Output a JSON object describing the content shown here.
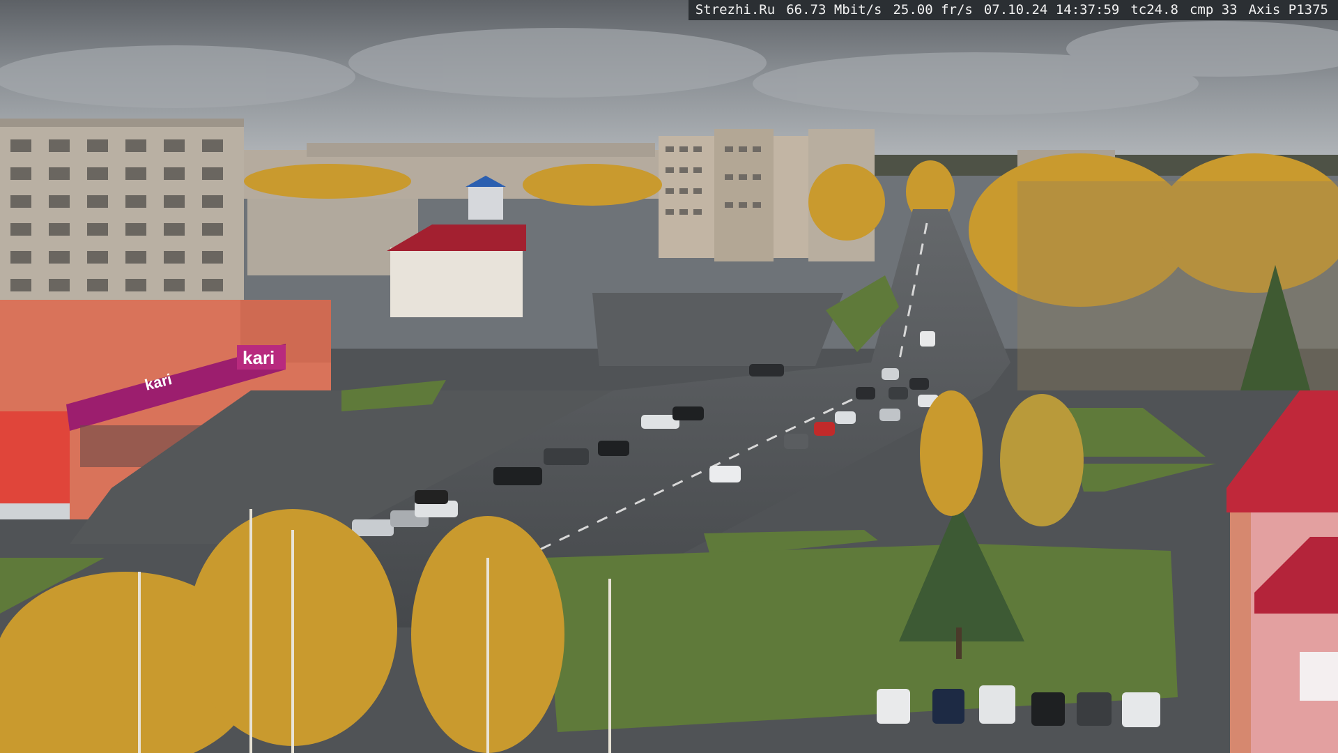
{
  "overlay": {
    "site": "Strezhi.Ru",
    "bitrate": "66.73 Mbit/s",
    "fps": "25.00 fr/s",
    "datetime": "07.10.24 14:37:59",
    "tc": "tc24.8",
    "cmp": "cmp 33",
    "camera": "Axis P1375"
  },
  "store_signs": {
    "main_logo": "kari",
    "secondary_logo": "kari"
  },
  "colors": {
    "sky": "#8c9196",
    "asphalt": "#4a4d50",
    "grass": "#5f7a3a",
    "autumn_foliage": "#c99a2e",
    "magenta_sign": "#9c1e6e",
    "brick_building": "#d9735a",
    "red_roof": "#c0283a"
  }
}
